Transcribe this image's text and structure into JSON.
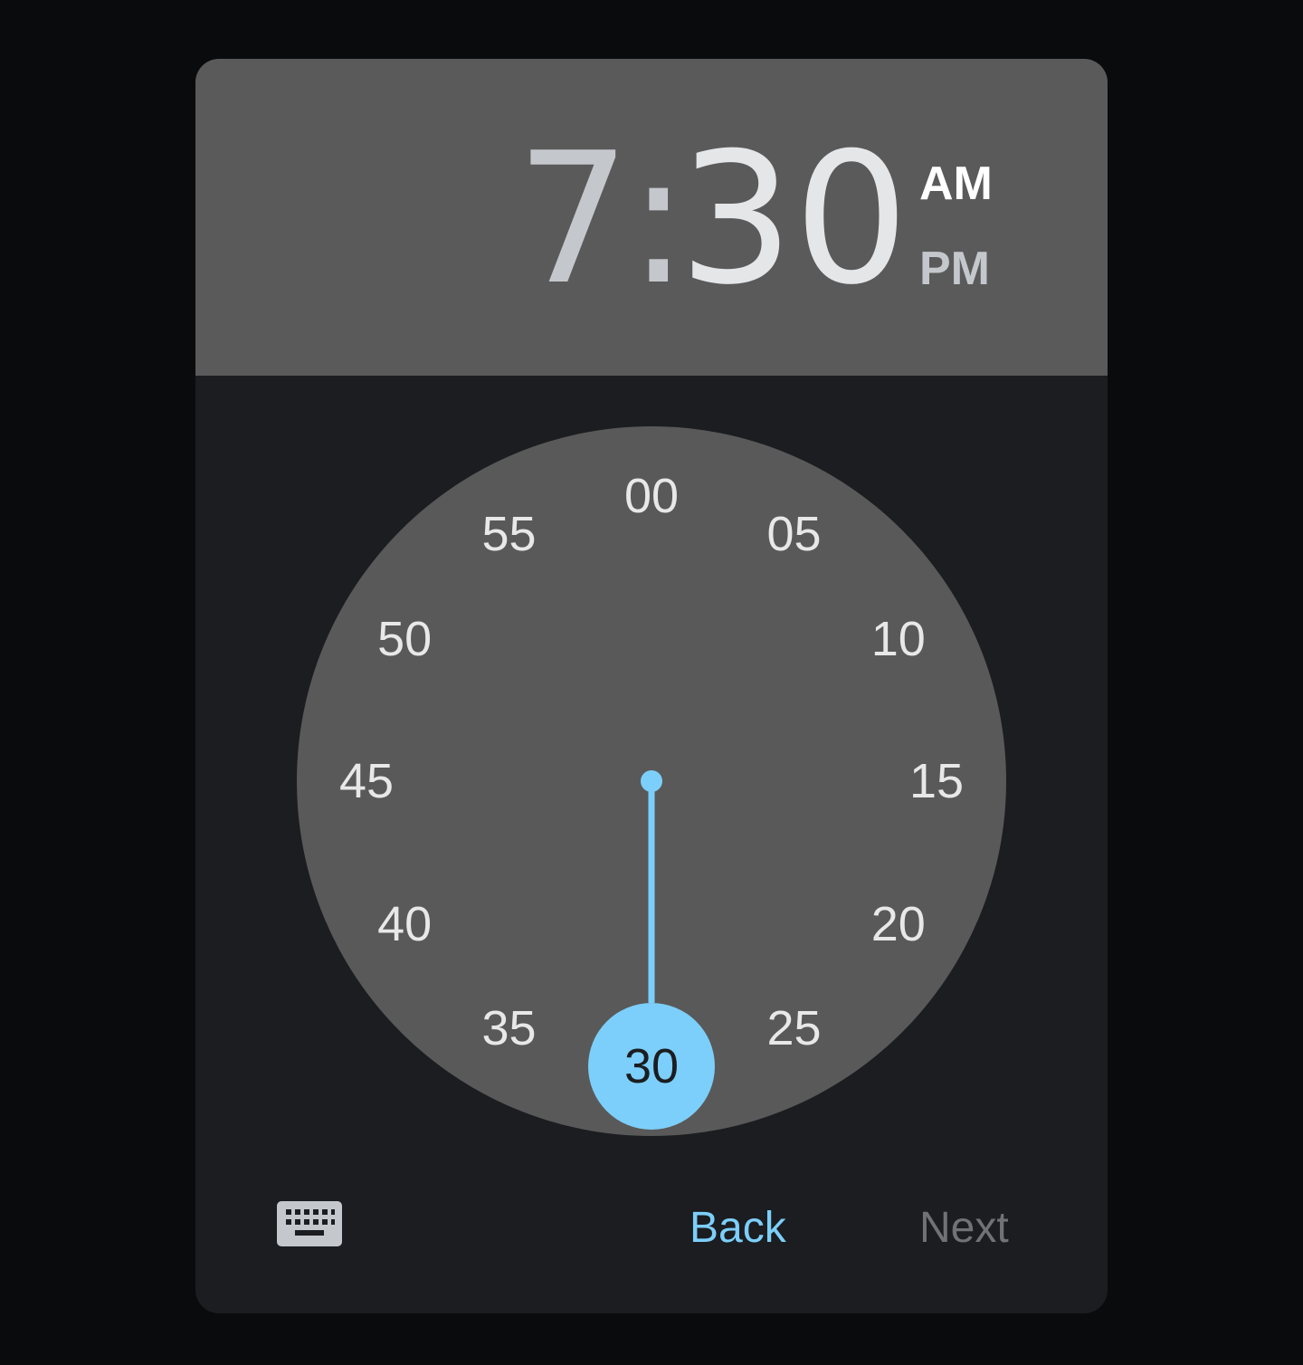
{
  "time": {
    "hour": "7",
    "separator": ":",
    "minute": "30"
  },
  "period": {
    "am_label": "AM",
    "pm_label": "PM",
    "selected": "AM"
  },
  "clock": {
    "minutes": [
      "00",
      "05",
      "10",
      "15",
      "20",
      "25",
      "30",
      "35",
      "40",
      "45",
      "50",
      "55"
    ],
    "selected_minute": "30",
    "hand_color": "#7ccffa",
    "face_color": "#595959"
  },
  "actions": {
    "keyboard_icon": "keyboard-icon",
    "back_label": "Back",
    "next_label": "Next"
  },
  "colors": {
    "accent": "#7ccffa",
    "header_bg": "#5a5a5a",
    "dialog_bg": "#1b1d20",
    "disabled_text": "#707275"
  }
}
